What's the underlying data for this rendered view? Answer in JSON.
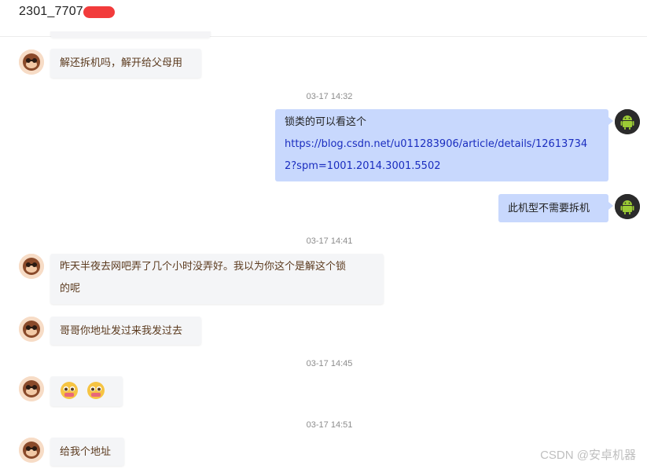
{
  "header": {
    "title": "2301_7707"
  },
  "colors": {
    "redaction": "#f23b3b",
    "self_bubble": "#c8d8fd",
    "peer_bubble": "#f4f5f7",
    "peer_text": "#5b3a1e"
  },
  "messages": [
    {
      "side": "left",
      "avatar": "monkey-avatar-icon",
      "text": "解还拆机吗，解开给父母用"
    },
    {
      "time": "03-17 14:32"
    },
    {
      "side": "right",
      "avatar": "android-avatar-icon",
      "text": "锁类的可以看这个",
      "link_line1": "https://blog.csdn.net/u011283906/article/details/12613734",
      "link_line2": "2?spm=1001.2014.3001.5502"
    },
    {
      "side": "right",
      "avatar": "android-avatar-icon",
      "text": "此机型不需要拆机"
    },
    {
      "time": "03-17 14:41"
    },
    {
      "side": "left",
      "avatar": "monkey-avatar-icon",
      "text": "昨天半夜去网吧弄了几个小时没弄好。我以为你这个是解这个锁",
      "text_line2": "的呢"
    },
    {
      "side": "left",
      "avatar": "monkey-avatar-icon",
      "text": "哥哥你地址发过来我发过去"
    },
    {
      "time": "03-17 14:45"
    },
    {
      "side": "left",
      "avatar": "monkey-avatar-icon",
      "emoji": [
        "pleading-face-emoji",
        "pleading-face-emoji"
      ]
    },
    {
      "time": "03-17 14:51"
    },
    {
      "side": "left",
      "avatar": "monkey-avatar-icon",
      "text": "给我个地址"
    }
  ],
  "watermark": "CSDN @安卓机器"
}
